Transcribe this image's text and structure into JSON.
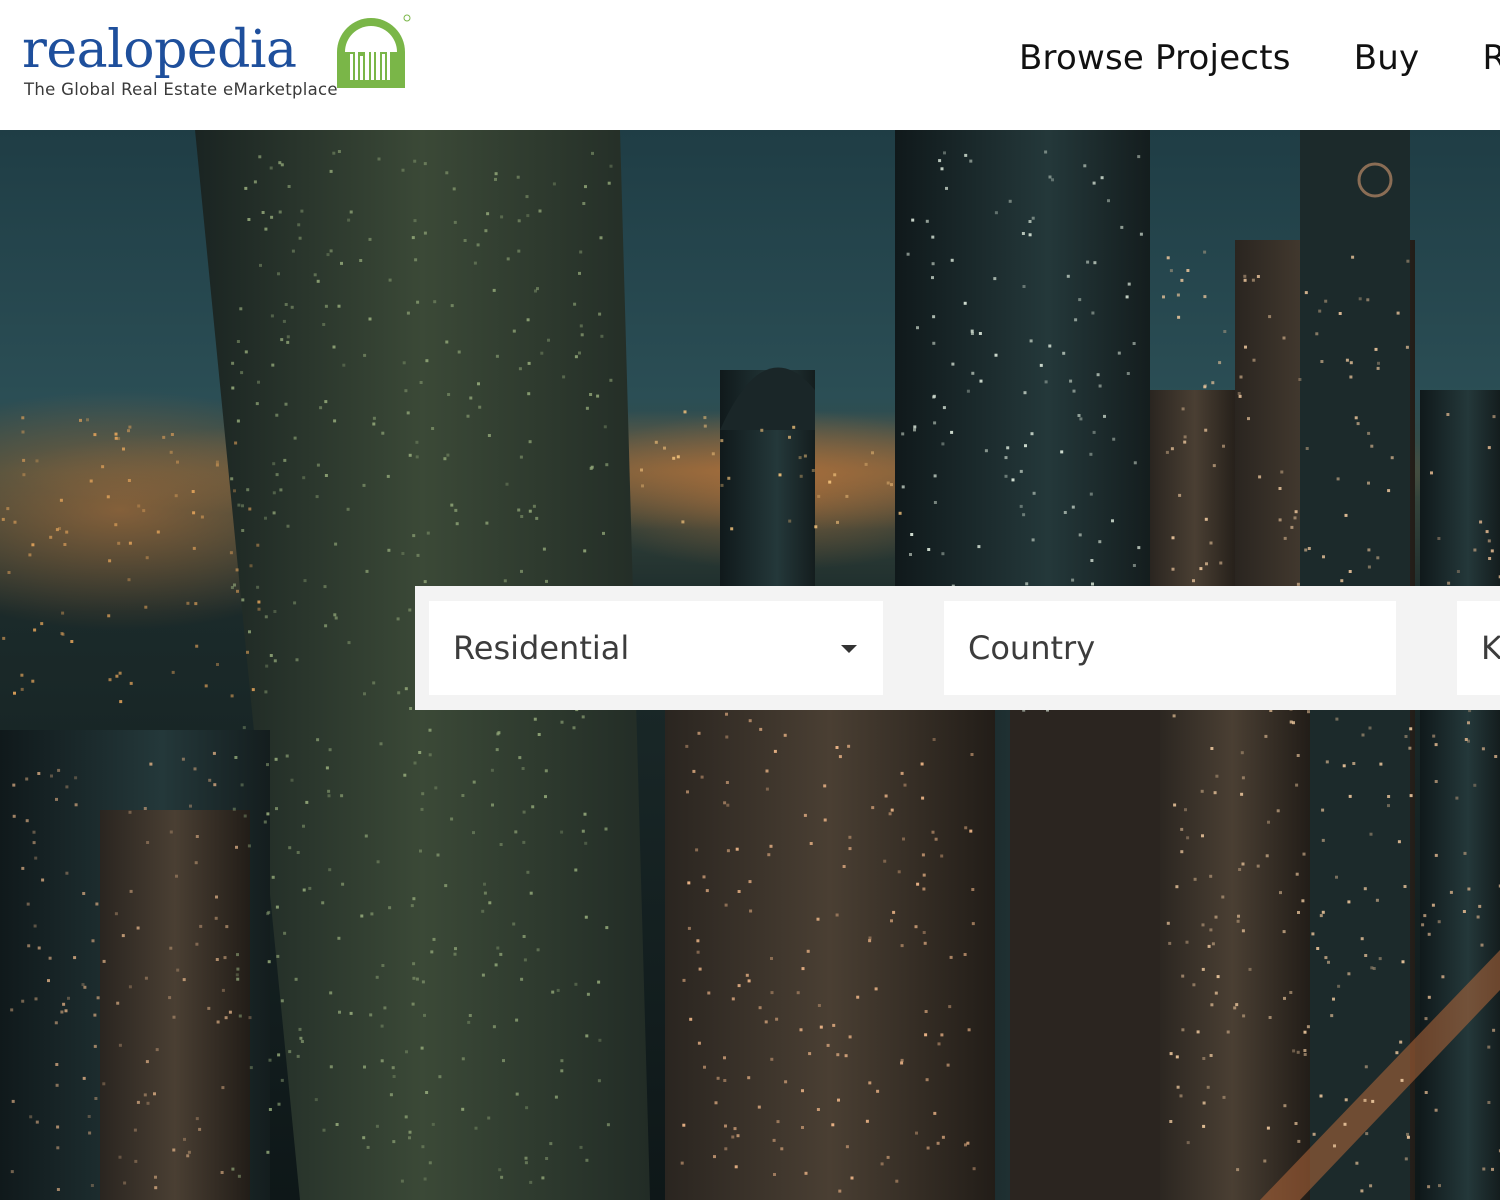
{
  "brand": {
    "name": "realopedia",
    "tagline": "The Global Real Estate eMarketplace",
    "logo_color": "#1e4f9c",
    "mark_color": "#7ab648"
  },
  "nav": {
    "items": [
      "Browse Projects",
      "Buy",
      "R"
    ]
  },
  "hero": {
    "image": "night-city-skyline-icon"
  },
  "search": {
    "property_type": "Residential",
    "country_placeholder": "Country",
    "keyword_placeholder": "K"
  }
}
